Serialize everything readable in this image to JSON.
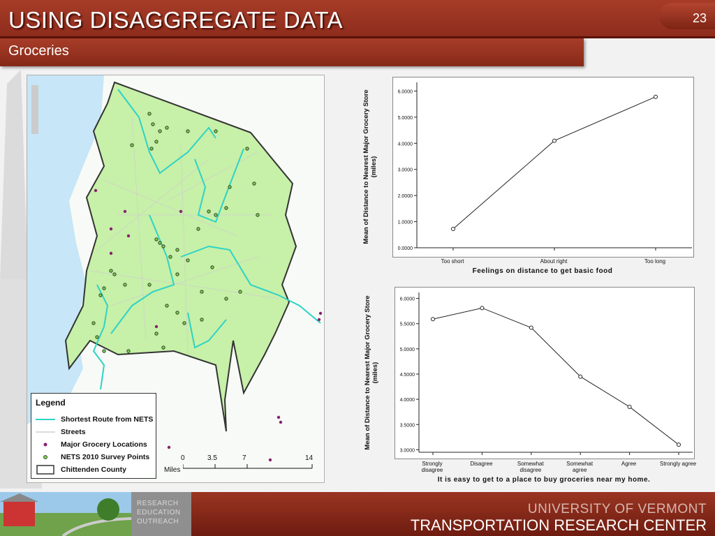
{
  "header": {
    "title": "USING DISAGGREGATE DATA",
    "page_number": "23"
  },
  "subheader": {
    "subtitle": "Groceries"
  },
  "map": {
    "legend": {
      "title": "Legend",
      "items": [
        {
          "label": "Shortest Route from NETS",
          "symbol": "line",
          "color": "#2ed3c6"
        },
        {
          "label": "Streets",
          "symbol": "line",
          "color": "#cfcfcf"
        },
        {
          "label": "Major Grocery Locations",
          "symbol": "dot",
          "color": "#8a1f6e"
        },
        {
          "label": "NETS 2010 Survey Points",
          "symbol": "dot",
          "color": "#79d14a"
        },
        {
          "label": "Chittenden County",
          "symbol": "box",
          "color": "#333333"
        }
      ]
    },
    "scale": {
      "label": "Miles",
      "ticks": [
        "0",
        "3.5",
        "7",
        "14"
      ]
    },
    "colors": {
      "county_fill": "#c7f0a8",
      "water": "#c7e6f7",
      "route": "#2ed3c6",
      "grocery": "#8a1f6e",
      "survey": "#79d14a"
    }
  },
  "chart_data": [
    {
      "type": "line",
      "categories": [
        "Too short",
        "About right",
        "Too long"
      ],
      "values": [
        0.72,
        4.1,
        5.78
      ],
      "xlabel": "Feelings on distance to get basic food",
      "ylabel": "Mean of Distance to Nearest Major Grocery Store (miles)",
      "yticks": [
        "0.0000",
        "1.0000",
        "2.0000",
        "3.0000",
        "4.0000",
        "5.0000",
        "6.0000"
      ],
      "ylim": [
        0,
        6.2
      ]
    },
    {
      "type": "line",
      "categories": [
        "Strongly disagree",
        "Disagree",
        "Somewhat disagree",
        "Somewhat agree",
        "Agree",
        "Strongly agree"
      ],
      "values": [
        5.59,
        5.81,
        5.42,
        4.45,
        3.85,
        3.1
      ],
      "xlabel": "It is easy to get to a place to buy groceries near my home.",
      "ylabel": "Mean of Distance to Nearest Major Grocery Store (miles)",
      "yticks": [
        "3.0000",
        "3.5000",
        "4.0000",
        "4.5000",
        "5.0000",
        "5.5000",
        "6.0000"
      ],
      "ylim": [
        2.95,
        6.05
      ]
    }
  ],
  "footer": {
    "logo_lines": [
      "RESEARCH",
      "EDUCATION",
      "OUTREACH"
    ],
    "university": "UNIVERSITY OF VERMONT",
    "center": "TRANSPORTATION RESEARCH CENTER"
  }
}
